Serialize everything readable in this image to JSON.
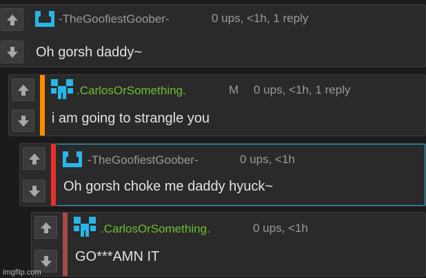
{
  "comments": [
    {
      "username": "-TheGoofiestGoober-",
      "meta": "0 ups, <1h, 1 reply",
      "text": "Oh gorsh daddy~"
    },
    {
      "username": ".CarlosOrSomething.",
      "badge": "M",
      "meta": "0 ups, <1h, 1 reply",
      "text": "i am going to strangle you"
    },
    {
      "username": "-TheGoofiestGoober-",
      "meta": "0 ups, <1h",
      "text": "Oh gorsh choke me daddy hyuck~"
    },
    {
      "username": ".CarlosOrSomething.",
      "meta": "0 ups, <1h",
      "text": "GO***AMN IT"
    }
  ],
  "watermark": "imgflip.com",
  "colors": {
    "background": "#1b1b1b",
    "comment_bg": "#2a2a2b",
    "accent_orange": "#ff8c00",
    "accent_red": "#e8302a",
    "accent_darkred": "#a64a4a",
    "avatar_blue": "#28b6e8",
    "highlight_border": "#2aa7d6",
    "username_green": "#6fbf2f"
  },
  "icons": [
    "upvote-arrow-icon",
    "downvote-arrow-icon",
    "user-avatar-icon"
  ]
}
